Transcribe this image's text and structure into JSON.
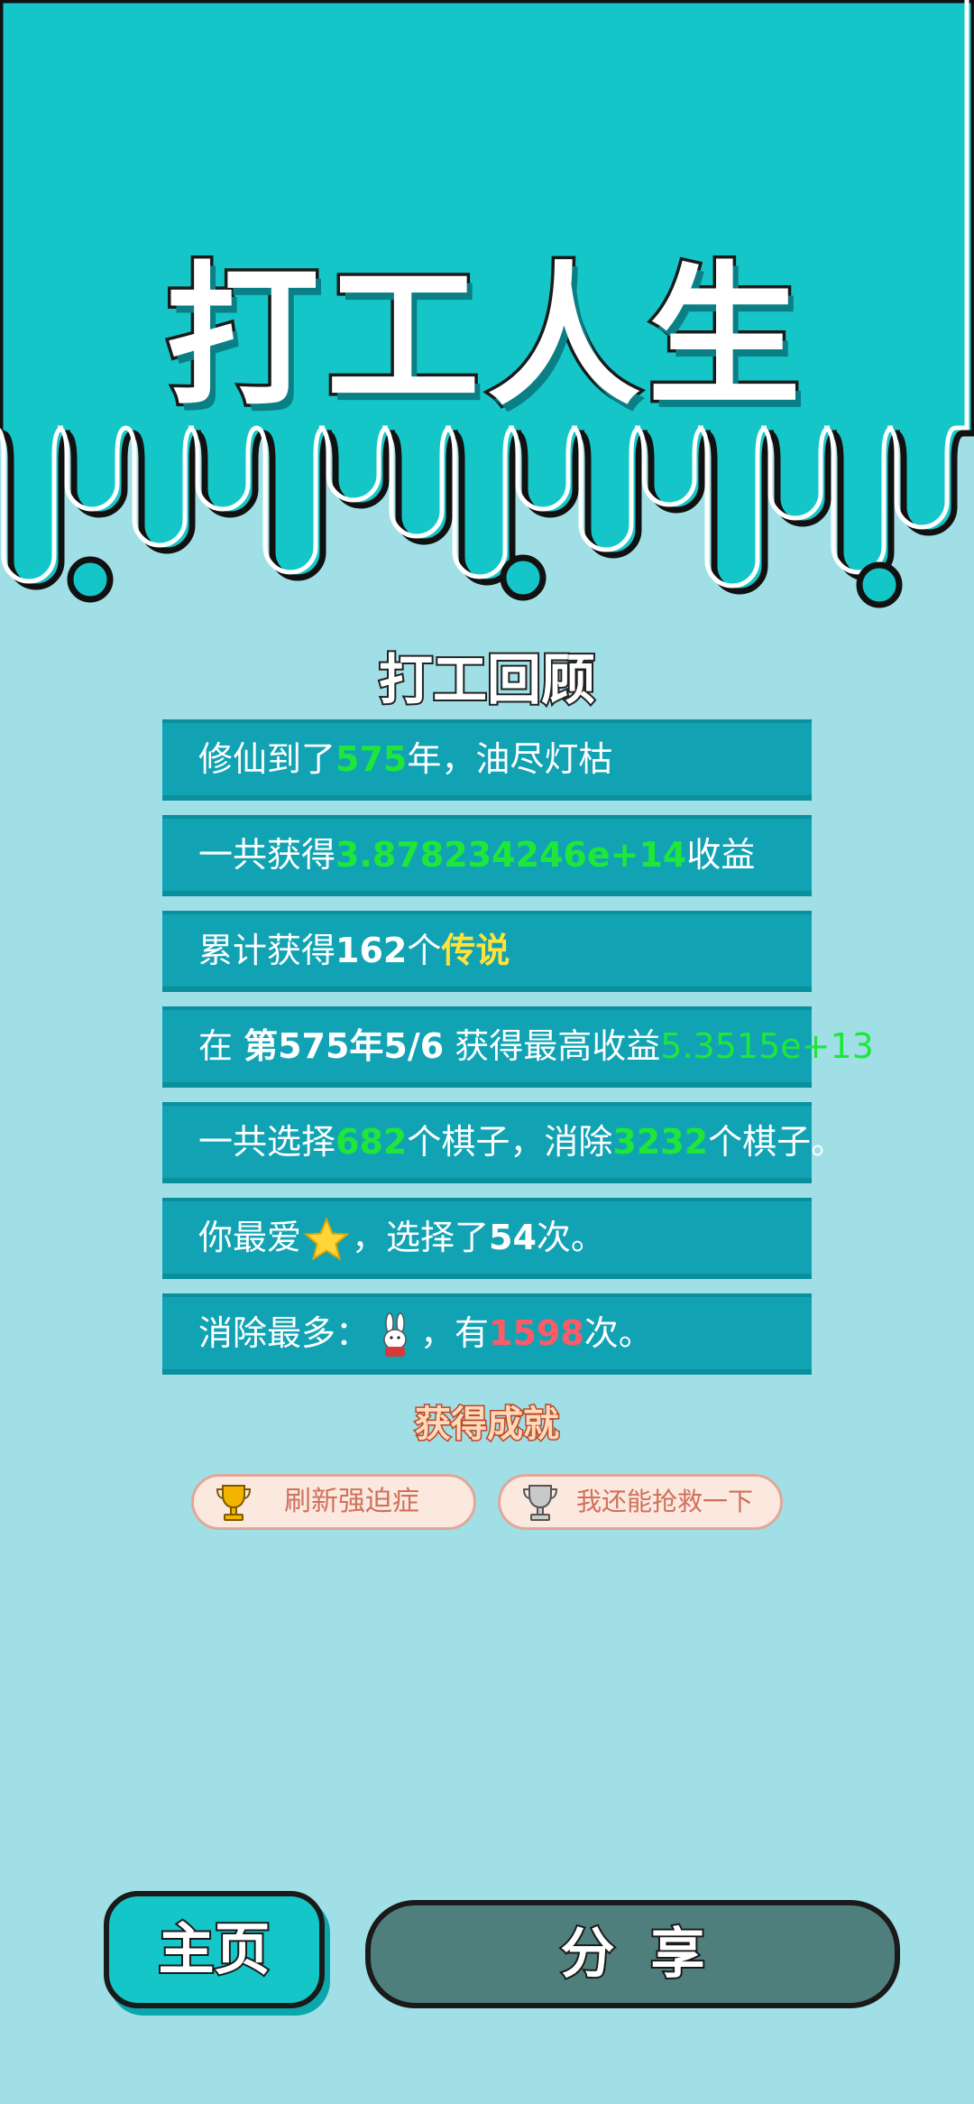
{
  "game": {
    "title": "打工人生",
    "review_title": "打工回顾",
    "achievements_title": "获得成就"
  },
  "stats": {
    "r1": {
      "a": "修仙到了",
      "v": "575",
      "b": "年，油尽灯枯"
    },
    "r2": {
      "a": "一共获得",
      "v": "3.878234246e+14",
      "b": "收益"
    },
    "r3": {
      "a": "累计获得",
      "n": "162",
      "m": "个",
      "v": "传说"
    },
    "r4": {
      "a": "在 ",
      "n": "第575年5/6",
      "m": " 获得最高收益",
      "v": "5.3515e+13"
    },
    "r5": {
      "a": "一共选择",
      "v1": "682",
      "m": "个棋子，消除",
      "v2": "3232",
      "b": "个棋子。"
    },
    "r6": {
      "a": "你最爱",
      "icon": "star-icon",
      "m": "，选择了",
      "n": "54",
      "b": "次。"
    },
    "r7": {
      "a": "消除最多：",
      "icon": "rabbit-icon",
      "m": "，有",
      "v": "1598",
      "b": "次。"
    }
  },
  "achievements": [
    {
      "label": "刷新强迫症",
      "icon": "gold-trophy-icon"
    },
    {
      "label": "我还能抢救一下",
      "icon": "silver-trophy-icon"
    }
  ],
  "buttons": {
    "home": "主页",
    "share": "分享"
  },
  "colors": {
    "top_teal": "#15c6c8",
    "background": "#a1dfe6",
    "row": "#11a3b3",
    "highlight_green": "#1ee73a",
    "highlight_yellow": "#ffe23a",
    "highlight_red": "#ff5a66"
  }
}
